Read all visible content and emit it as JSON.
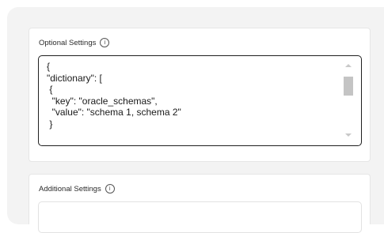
{
  "optional_settings": {
    "label": "Optional Settings",
    "info_icon": "info-icon",
    "editor_value": "{\n\"dictionary\": [\n {\n  \"key\": \"oracle_schemas\",\n  \"value\": \"schema 1, schema 2\"\n }"
  },
  "additional_settings": {
    "label": "Additional Settings",
    "info_icon": "info-icon"
  }
}
